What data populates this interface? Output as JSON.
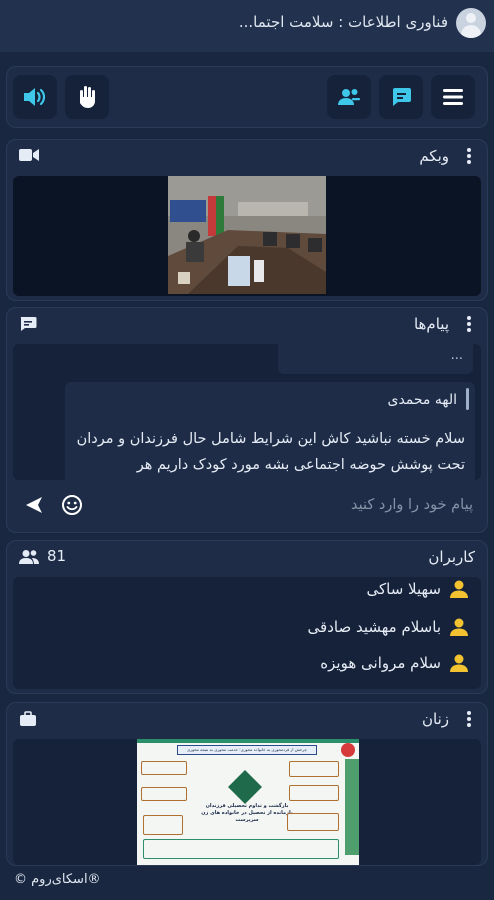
{
  "topbar": {
    "title": "فناوری اطلاعات : سلامت اجتما..."
  },
  "controls": {
    "speaker": "speaker-icon",
    "hand": "raise-hand-icon",
    "users": "users-icon",
    "chat": "chat-icon",
    "menu": "menu-icon"
  },
  "webcam": {
    "title": "وبکم"
  },
  "messages": {
    "title": "پیام‌ها",
    "previous_fragment": "...",
    "sender": "الهه محمدی",
    "text": "سلام خسته نباشید  کاش این شرایط شامل حال فرزندان و مردان تحت پوشش حوضه اجتماعی بشه مورد کودک داریم  هر",
    "input_placeholder": "پیام خود را وارد کنید"
  },
  "users": {
    "title": "کاربران",
    "count": "81",
    "items": [
      {
        "name": "سهیلا ساکی"
      },
      {
        "name": "باسلام مهشید صادقی"
      },
      {
        "name": "سلام مروانی هویزه"
      }
    ]
  },
  "women": {
    "title": "زنان",
    "doc_header": "چرخش از فردمحوری به خانواده محوری: خدمت محوری به نتیجه محوری",
    "doc_center": "بازگشت و تداوم تحصیلی فرزندان بازمانده از تحصیل در خانواده های زن سرپرست"
  },
  "footer": {
    "text": "®اسکای‌روم ©"
  },
  "colors": {
    "accent": "#3ec7e8",
    "user_icon": "#f2c230",
    "panel": "#1e2c47",
    "background": "#1a2740"
  }
}
